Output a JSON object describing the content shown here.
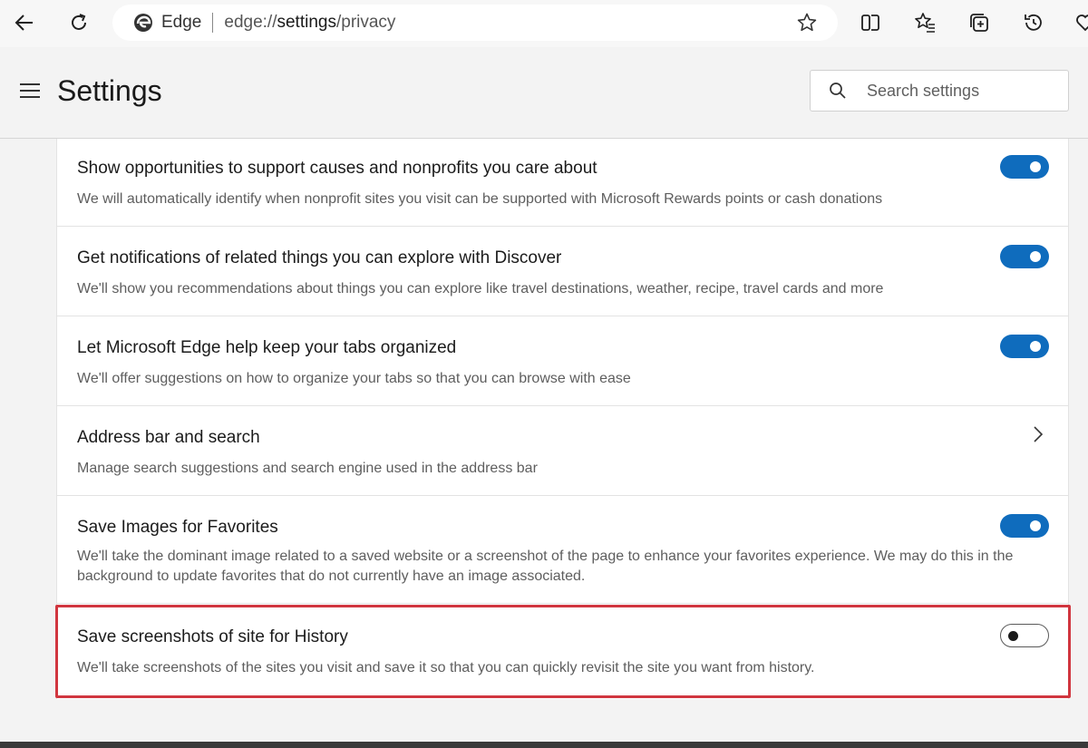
{
  "browser": {
    "site_name": "Edge",
    "url_prefix": "edge://",
    "url_host": "settings",
    "url_path": "/privacy"
  },
  "header": {
    "title": "Settings",
    "search_placeholder": "Search settings"
  },
  "settings": [
    {
      "title": "Show opportunities to support causes and nonprofits you care about",
      "description": "We will automatically identify when nonprofit sites you visit can be supported with Microsoft Rewards points or cash donations",
      "control": "toggle",
      "enabled": true
    },
    {
      "title": "Get notifications of related things you can explore with Discover",
      "description": "We'll show you recommendations about things you can explore like travel destinations, weather, recipe, travel cards and more",
      "control": "toggle",
      "enabled": true
    },
    {
      "title": "Let Microsoft Edge help keep your tabs organized",
      "description": "We'll offer suggestions on how to organize your tabs so that you can browse with ease",
      "control": "toggle",
      "enabled": true
    },
    {
      "title": "Address bar and search",
      "description": "Manage search suggestions and search engine used in the address bar",
      "control": "link"
    },
    {
      "title": "Save Images for Favorites",
      "description": "We'll take the dominant image related to a saved website or a screenshot of the page to enhance your favorites experience. We may do this in the background to update favorites that do not currently have an image associated.",
      "control": "toggle",
      "enabled": true
    },
    {
      "title": "Save screenshots of site for History",
      "description": "We'll take screenshots of the sites you visit and save it so that you can quickly revisit the site you want from history.",
      "control": "toggle",
      "enabled": false
    }
  ],
  "colors": {
    "accent": "#0f6cbd",
    "highlight_border": "#d1363f"
  }
}
